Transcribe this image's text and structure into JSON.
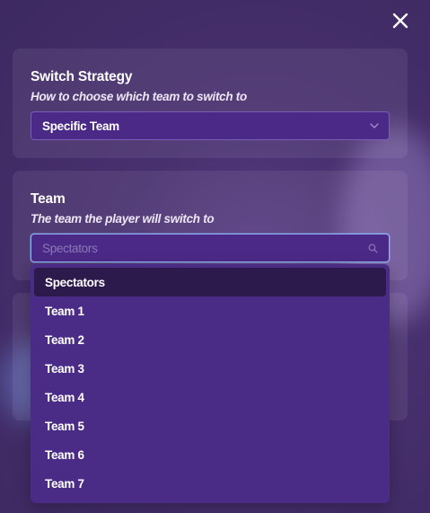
{
  "close": {
    "icon": "close-icon"
  },
  "strategy": {
    "title": "Switch Strategy",
    "subtitle": "How to choose which team to switch to",
    "selected": "Specific Team",
    "icon": "chevron-down-icon"
  },
  "team": {
    "title": "Team",
    "subtitle": "The team the player will switch to",
    "placeholder": "Spectators",
    "icon": "search-icon"
  },
  "dropdown": {
    "options": [
      "Spectators",
      "Team 1",
      "Team 2",
      "Team 3",
      "Team 4",
      "Team 5",
      "Team 6",
      "Team 7"
    ],
    "active_index": 0
  },
  "colors": {
    "background": "#48306e",
    "field": "#4b2a87",
    "dropdown": "#4a2b86",
    "active_option": "#2c1a4c",
    "focus_border": "#8fb4f5"
  }
}
